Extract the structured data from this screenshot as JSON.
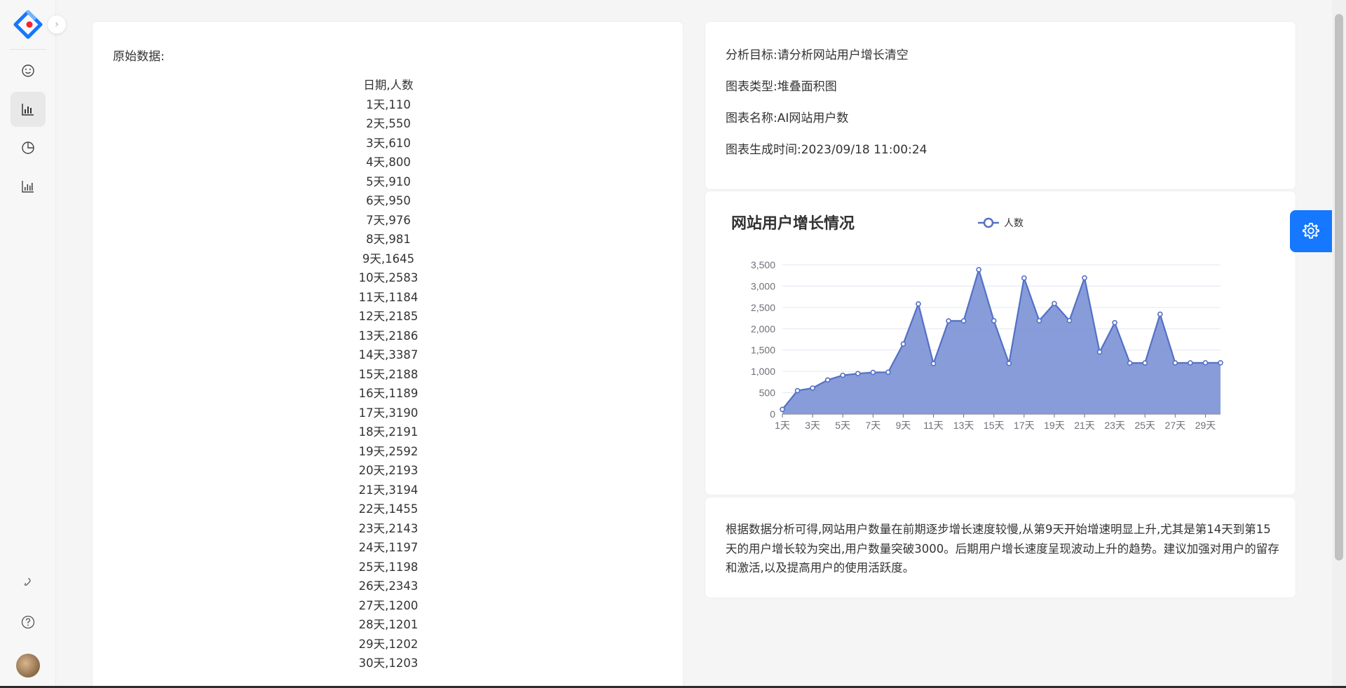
{
  "raw": {
    "title": "原始数据:",
    "header": "日期,人数",
    "rows": [
      "1天,110",
      "2天,550",
      "3天,610",
      "4天,800",
      "5天,910",
      "6天,950",
      "7天,976",
      "8天,981",
      "9天,1645",
      "10天,2583",
      "11天,1184",
      "12天,2185",
      "13天,2186",
      "14天,3387",
      "15天,2188",
      "16天,1189",
      "17天,3190",
      "18天,2191",
      "19天,2592",
      "20天,2193",
      "21天,3194",
      "22天,1455",
      "23天,2143",
      "24天,1197",
      "25天,1198",
      "26天,2343",
      "27天,1200",
      "28天,1201",
      "29天,1202",
      "30天,1203"
    ]
  },
  "meta": {
    "goal": "分析目标:请分析网站用户增长清空",
    "chart_type": "图表类型:堆叠面积图",
    "chart_name": "图表名称:AI网站用户数",
    "generated_at": "图表生成时间:2023/09/18 11:00:24"
  },
  "analysis": "根据数据分析可得,网站用户数量在前期逐步增长速度较慢,从第9天开始增速明显上升,尤其是第14天到第15天的用户增长较为突出,用户数量突破3000。后期用户增长速度呈现波动上升的趋势。建议加强对用户的留存和激活,以及提高用户的使用活跃度。",
  "colors": {
    "accent": "#1677ff",
    "series_line": "#5470c6",
    "series_fill": "#7b91d6"
  },
  "chart_data": {
    "type": "area",
    "title": "网站用户增长情况",
    "legend": "人数",
    "legend_position": "top-center",
    "grid": true,
    "categories": [
      "1天",
      "2天",
      "3天",
      "4天",
      "5天",
      "6天",
      "7天",
      "8天",
      "9天",
      "10天",
      "11天",
      "12天",
      "13天",
      "14天",
      "15天",
      "16天",
      "17天",
      "18天",
      "19天",
      "20天",
      "21天",
      "22天",
      "23天",
      "24天",
      "25天",
      "26天",
      "27天",
      "28天",
      "29天",
      "30天"
    ],
    "x_tick_labels": [
      "1天",
      "3天",
      "5天",
      "7天",
      "9天",
      "11天",
      "13天",
      "15天",
      "17天",
      "19天",
      "21天",
      "23天",
      "25天",
      "27天",
      "29天"
    ],
    "series": [
      {
        "name": "人数",
        "values": [
          110,
          550,
          610,
          800,
          910,
          950,
          976,
          981,
          1645,
          2583,
          1184,
          2185,
          2186,
          3387,
          2188,
          1189,
          3190,
          2191,
          2592,
          2193,
          3194,
          1455,
          2143,
          1197,
          1198,
          2343,
          1200,
          1201,
          1202,
          1203
        ]
      }
    ],
    "ylim": [
      0,
      3500
    ],
    "y_ticks": [
      0,
      500,
      1000,
      1500,
      2000,
      2500,
      3000,
      3500
    ],
    "y_tick_labels": [
      "0",
      "500",
      "1,000",
      "1,500",
      "2,000",
      "2,500",
      "3,000",
      "3,500"
    ]
  }
}
